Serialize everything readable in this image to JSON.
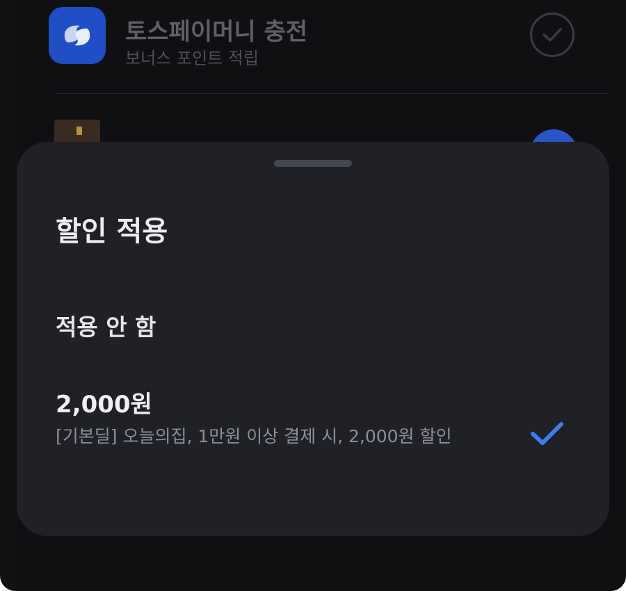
{
  "background_list": {
    "payment_option": {
      "title": "토스페이머니 충전",
      "subtitle": "보너스 포인트 적립",
      "icon": "toss-logo-icon"
    },
    "next_item_icon": "card-thumbnail"
  },
  "discount_sheet": {
    "title": "할인 적용",
    "options": [
      {
        "label": "적용 안 함",
        "selected": false
      },
      {
        "label": "2,000원",
        "description": "[기본딜] 오늘의집, 1만원 이상 결제 시, 2,000원 할인",
        "selected": true
      }
    ]
  },
  "colors": {
    "sheet_background": "#202027",
    "accent_check": "#3d7cf0",
    "toss_blue": "#1f4ec6"
  }
}
